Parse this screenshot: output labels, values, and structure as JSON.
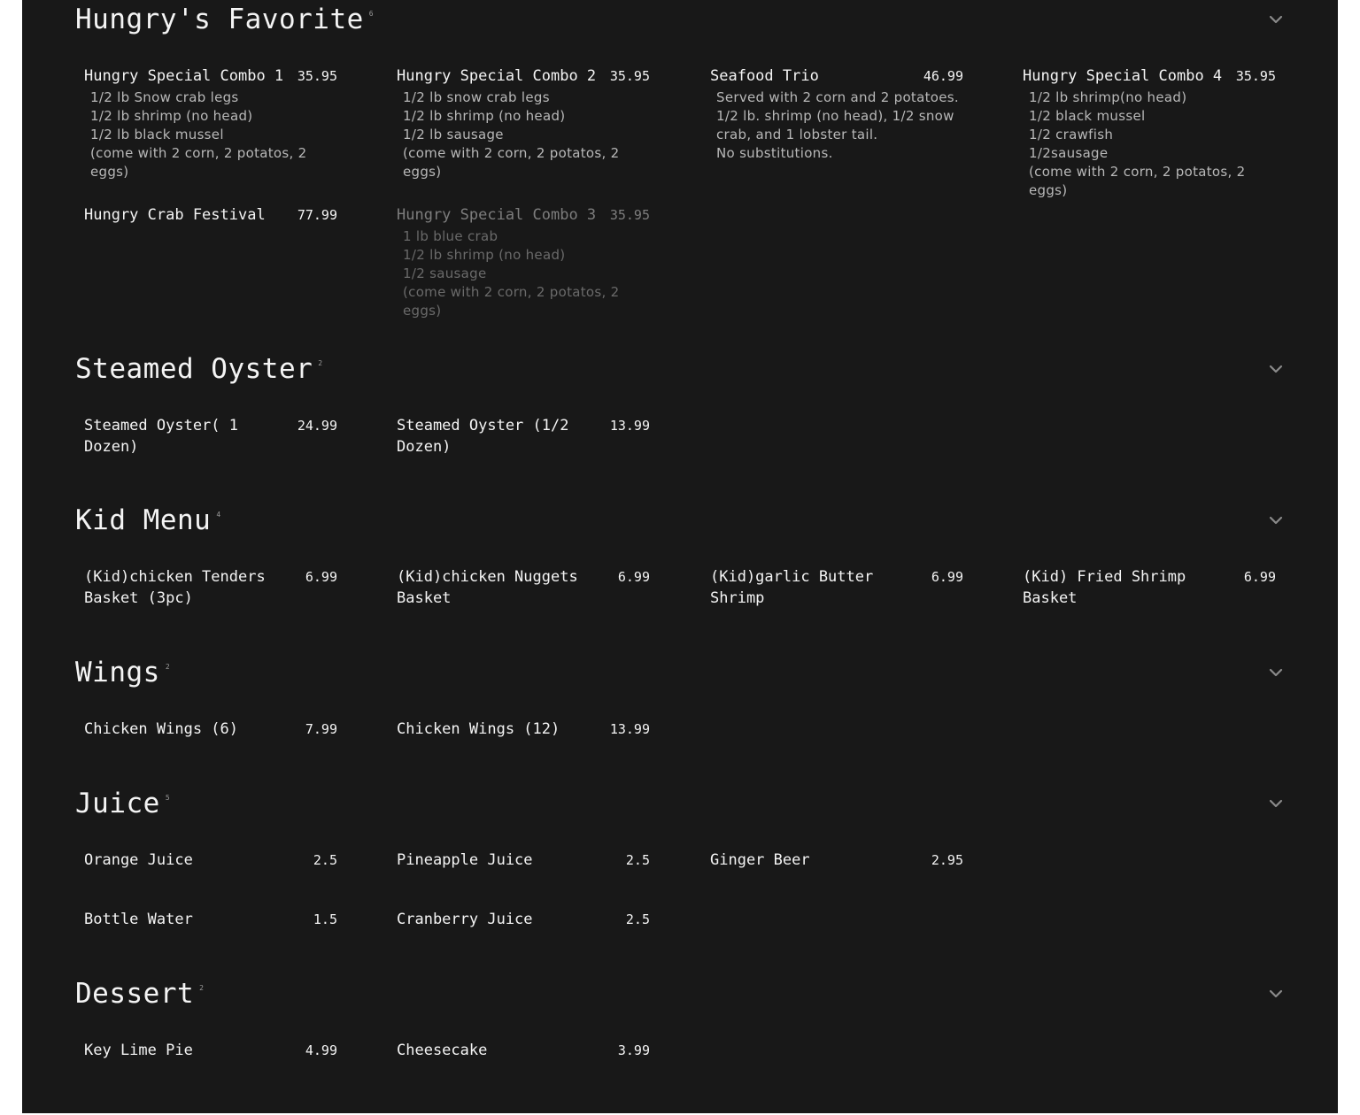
{
  "sections": [
    {
      "title": "Hungry's Favorite",
      "count": "6",
      "items": [
        {
          "name": "Hungry Special Combo 1",
          "price": "35.95",
          "desc": "1/2 lb Snow crab legs\n1/2 lb shrimp (no head)\n1/2 lb black mussel\n(come with 2 corn, 2 potatos, 2 eggs)",
          "unavailable": false
        },
        {
          "name": "Hungry Special Combo 2",
          "price": "35.95",
          "desc": "1/2 lb snow crab legs\n1/2 lb shrimp (no head)\n1/2 lb sausage\n(come with 2 corn, 2 potatos, 2 eggs)",
          "unavailable": false
        },
        {
          "name": "Seafood Trio",
          "price": "46.99",
          "desc": "Served with 2 corn and 2 potatoes. 1/2 lb. shrimp (no head), 1/2 snow crab, and 1 lobster tail.\nNo substitutions.",
          "unavailable": false
        },
        {
          "name": "Hungry Special Combo 4",
          "price": "35.95",
          "desc": "1/2 lb shrimp(no head)\n1/2 black mussel\n1/2 crawfish\n1/2sausage\n(come with 2 corn, 2 potatos, 2 eggs)",
          "unavailable": false
        },
        {
          "name": "Hungry Crab Festival",
          "price": "77.99",
          "desc": "",
          "unavailable": false
        },
        {
          "name": "Hungry Special Combo 3",
          "price": "35.95",
          "desc": "1 lb blue crab\n1/2 lb shrimp (no head)\n1/2 sausage\n(come with 2 corn, 2 potatos, 2 eggs)",
          "unavailable": true
        }
      ]
    },
    {
      "title": "Steamed Oyster",
      "count": "2",
      "items": [
        {
          "name": "Steamed Oyster( 1 Dozen)",
          "price": "24.99",
          "desc": "",
          "unavailable": false
        },
        {
          "name": "Steamed Oyster (1/2 Dozen)",
          "price": "13.99",
          "desc": "",
          "unavailable": false
        }
      ]
    },
    {
      "title": "Kid Menu",
      "count": "4",
      "items": [
        {
          "name": "(Kid)chicken Tenders Basket (3pc)",
          "price": "6.99",
          "desc": "",
          "unavailable": false
        },
        {
          "name": "(Kid)chicken Nuggets Basket",
          "price": "6.99",
          "desc": "",
          "unavailable": false
        },
        {
          "name": "(Kid)garlic Butter Shrimp",
          "price": "6.99",
          "desc": "",
          "unavailable": false
        },
        {
          "name": "(Kid) Fried Shrimp Basket",
          "price": "6.99",
          "desc": "",
          "unavailable": false
        }
      ]
    },
    {
      "title": "Wings",
      "count": "2",
      "items": [
        {
          "name": "Chicken Wings (6)",
          "price": "7.99",
          "desc": "",
          "unavailable": false
        },
        {
          "name": "Chicken Wings (12)",
          "price": "13.99",
          "desc": "",
          "unavailable": false
        }
      ]
    },
    {
      "title": "Juice",
      "count": "5",
      "items": [
        {
          "name": "Orange Juice",
          "price": "2.5",
          "desc": "",
          "unavailable": false
        },
        {
          "name": "Pineapple Juice",
          "price": "2.5",
          "desc": "",
          "unavailable": false
        },
        {
          "name": "Ginger Beer",
          "price": "2.95",
          "desc": "",
          "unavailable": false
        },
        {
          "name": "Bottle Water",
          "price": "1.5",
          "desc": "",
          "unavailable": false
        },
        {
          "name": "Cranberry Juice",
          "price": "2.5",
          "desc": "",
          "unavailable": false
        }
      ]
    },
    {
      "title": "Dessert",
      "count": "2",
      "items": [
        {
          "name": "Key Lime Pie",
          "price": "4.99",
          "desc": "",
          "unavailable": false
        },
        {
          "name": "Cheesecake",
          "price": "3.99",
          "desc": "",
          "unavailable": false
        }
      ]
    }
  ],
  "icons": {
    "collapse": "chevron-down-icon"
  },
  "colors": {
    "background": "#181818",
    "text": "#f4f4f4",
    "muted": "#b8b8b8",
    "unavailable": "#7d7d7d"
  }
}
